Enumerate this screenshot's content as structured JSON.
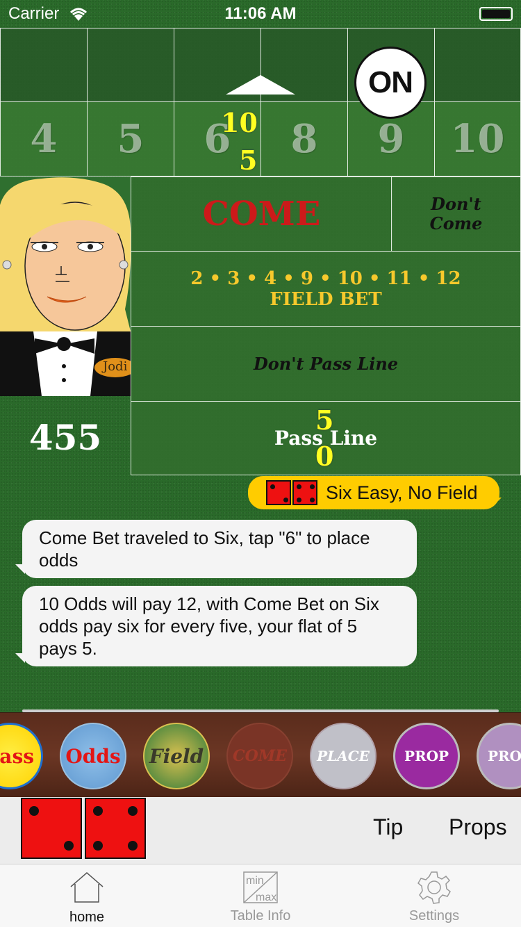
{
  "status_bar": {
    "carrier": "Carrier",
    "time": "11:06 AM"
  },
  "point_numbers": [
    "4",
    "5",
    "6",
    "8",
    "9",
    "10"
  ],
  "puck": {
    "label": "ON"
  },
  "chips": {
    "place_six_top": "10",
    "place_six_bottom": "5",
    "pass_line_top": "5",
    "pass_line_bottom": "0"
  },
  "bets": {
    "come": "COME",
    "dont_come": "Don't\nCome",
    "field_numbers": "2 • 3 • 4 • 9 • 10 • 11 • 12",
    "field_label": "FIELD BET",
    "dont_pass": "Don't Pass Line",
    "pass_line": "Pass Line"
  },
  "dealer": {
    "name_tag": "Jodi"
  },
  "bankroll": "455",
  "roll_message": {
    "text": "Six Easy, No Field",
    "dice": [
      2,
      4
    ]
  },
  "messages": [
    "Come Bet traveled to Six, tap \"6\" to place odds",
    "10 Odds will pay 12, with Come Bet on Six odds pay six for every five, your flat of 5 pays 5."
  ],
  "carousel": [
    "Pass",
    "Odds",
    "Field",
    "COME",
    "PLACE",
    "PROP",
    "PROP"
  ],
  "tray": {
    "dice": [
      2,
      4
    ],
    "tip_label": "Tip",
    "props_label": "Props"
  },
  "tabs": [
    {
      "label": "home",
      "icon": "home-icon",
      "active": true
    },
    {
      "label": "Table Info",
      "icon": "min-max-icon",
      "active": false
    },
    {
      "label": "Settings",
      "icon": "gear-icon",
      "active": false
    }
  ],
  "colors": {
    "felt": "#2a6a2a",
    "die": "#ee1111",
    "roll_bubble": "#ffcc00",
    "field_text": "#f7c92c",
    "come_text": "#cc1a1a",
    "chip_text": "#ffff22"
  }
}
